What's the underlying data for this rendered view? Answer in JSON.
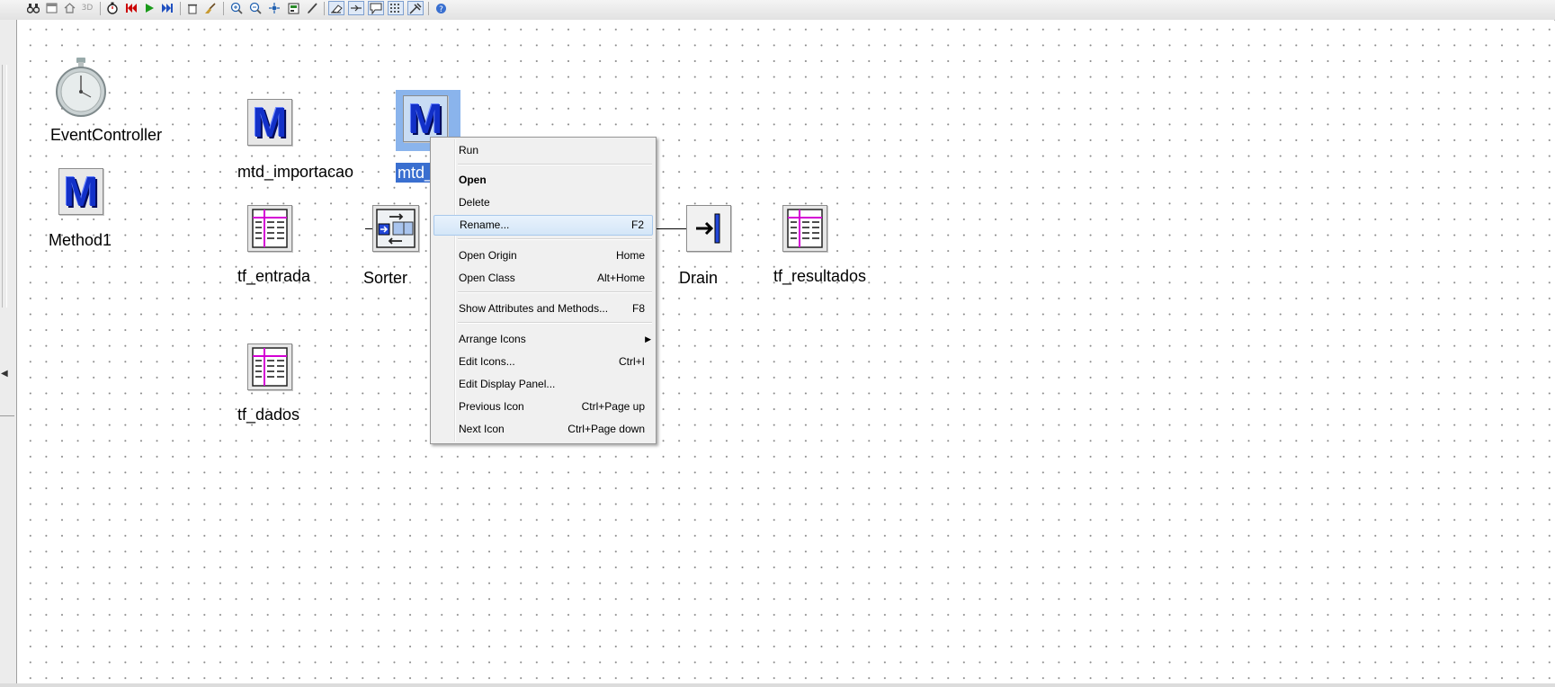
{
  "toolbar": {
    "icons": [
      "binoculars-icon",
      "window-icon",
      "home-icon",
      "3d-icon",
      "timer-icon",
      "rewind-icon",
      "play-icon",
      "fast-forward-icon",
      "delete-icon",
      "broom-icon",
      "zoom-in-icon",
      "zoom-out-icon",
      "fit-icon",
      "form-icon",
      "pencil-icon",
      "eraser-icon",
      "connector-icon",
      "comment-icon",
      "grid-icon",
      "tools-icon",
      "help-icon"
    ],
    "three_d_label": "3D"
  },
  "objects": {
    "event_controller": {
      "label": "EventController",
      "icon": "stopwatch-icon"
    },
    "method1": {
      "label": "Method1",
      "icon": "method-icon",
      "glyph": "M"
    },
    "mtd_importacao": {
      "label": "mtd_importacao",
      "icon": "method-icon",
      "glyph": "M"
    },
    "mtd_selected": {
      "label": "mtd_",
      "icon": "method-icon",
      "glyph": "M"
    },
    "tf_entrada": {
      "label": "tf_entrada",
      "icon": "table-icon"
    },
    "sorter": {
      "label": "Sorter",
      "icon": "sorter-icon"
    },
    "drain": {
      "label": "Drain",
      "icon": "drain-icon"
    },
    "tf_resultados": {
      "label": "tf_resultados",
      "icon": "table-icon"
    },
    "tf_dados": {
      "label": "tf_dados",
      "icon": "table-icon"
    }
  },
  "context_menu": {
    "items": [
      {
        "label": "Run",
        "shortcut": ""
      },
      {
        "label": "Open",
        "shortcut": ""
      },
      {
        "label": "Delete",
        "shortcut": ""
      },
      {
        "label": "Rename...",
        "shortcut": "F2"
      },
      {
        "label": "Open Origin",
        "shortcut": "Home"
      },
      {
        "label": "Open Class",
        "shortcut": "Alt+Home"
      },
      {
        "label": "Show Attributes and Methods...",
        "shortcut": "F8"
      },
      {
        "label": "Arrange Icons",
        "shortcut": ""
      },
      {
        "label": "Edit Icons...",
        "shortcut": "Ctrl+I"
      },
      {
        "label": "Edit Display Panel...",
        "shortcut": ""
      },
      {
        "label": "Previous Icon",
        "shortcut": "Ctrl+Page up"
      },
      {
        "label": "Next Icon",
        "shortcut": "Ctrl+Page down"
      }
    ],
    "highlighted_color": "#d4e6f8"
  },
  "colors": {
    "method_blue": "#1230c8",
    "selection_blue": "#3a6fd0",
    "table_magenta": "#d400d4"
  }
}
